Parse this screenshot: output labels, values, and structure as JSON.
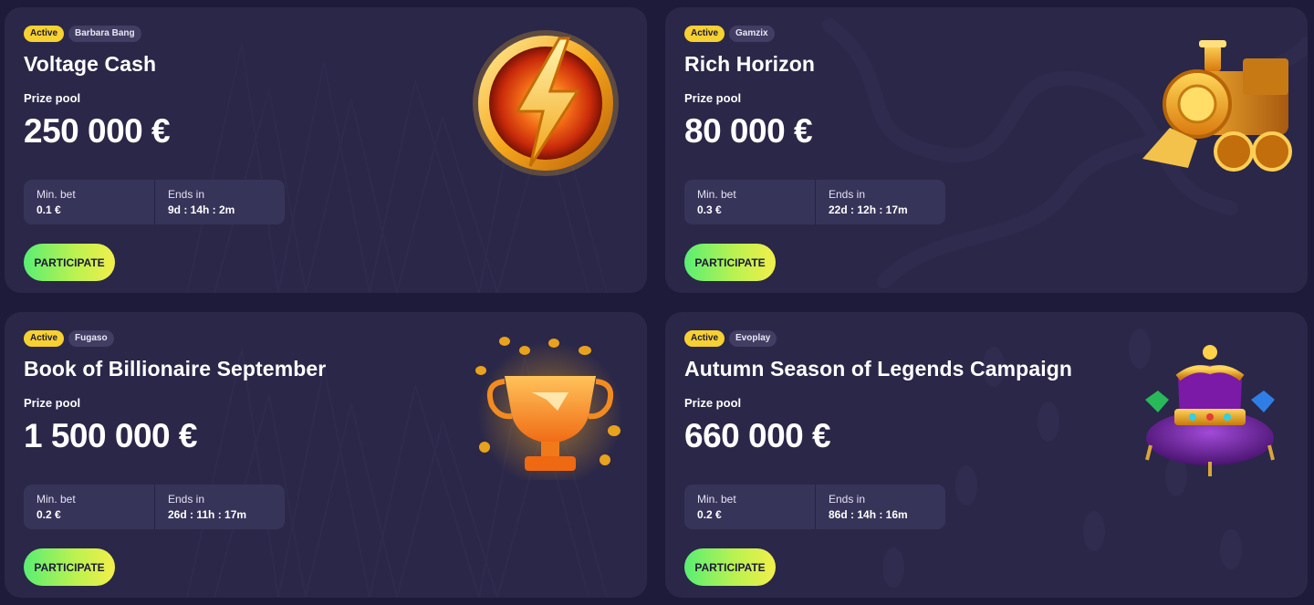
{
  "labels": {
    "active": "Active",
    "prize_pool": "Prize pool",
    "min_bet": "Min. bet",
    "ends_in": "Ends in",
    "participate": "PARTICIPATE"
  },
  "tournaments": [
    {
      "status": "Active",
      "provider": "Barbara Bang",
      "title": "Voltage Cash",
      "prize_pool": "250 000 €",
      "min_bet": "0.1 €",
      "ends_in": "9d : 14h : 2m",
      "icon": "lightning-orb-icon"
    },
    {
      "status": "Active",
      "provider": "Gamzix",
      "title": "Rich Horizon",
      "prize_pool": "80 000 €",
      "min_bet": "0.3 €",
      "ends_in": "22d : 12h : 17m",
      "icon": "golden-train-icon"
    },
    {
      "status": "Active",
      "provider": "Fugaso",
      "title": "Book of Billionaire September",
      "prize_pool": "1 500 000 €",
      "min_bet": "0.2 €",
      "ends_in": "26d : 11h : 17m",
      "icon": "trophy-coins-icon"
    },
    {
      "status": "Active",
      "provider": "Evoplay",
      "title": "Autumn Season of Legends Campaign",
      "prize_pool": "660 000 €",
      "min_bet": "0.2 €",
      "ends_in": "86d : 14h : 16m",
      "icon": "royal-crown-icon"
    }
  ],
  "colors": {
    "page_bg": "#1d1a3a",
    "card_bg": "#2a2748",
    "active_badge": "#f7d131",
    "button_gradient_start": "#59ee74",
    "button_gradient_end": "#f3ef4a"
  }
}
